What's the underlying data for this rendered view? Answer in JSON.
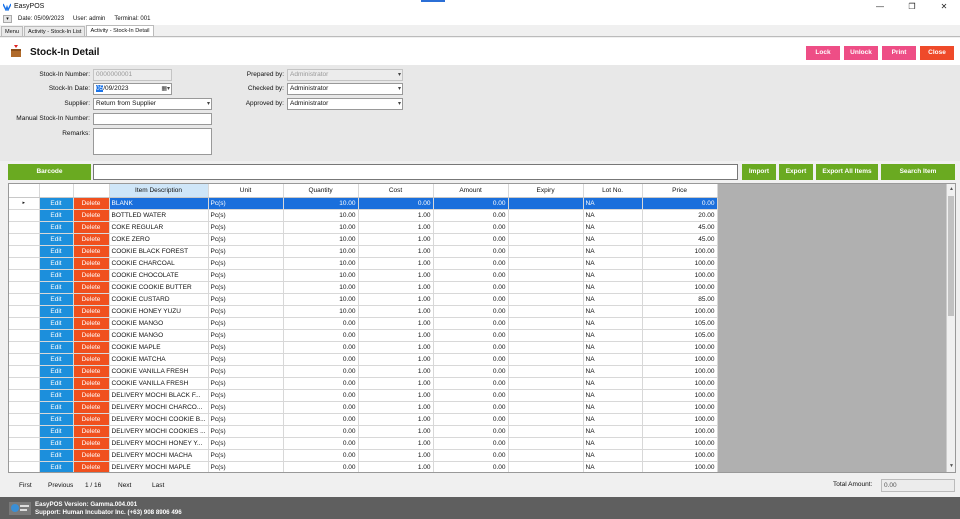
{
  "window": {
    "title": "EasyPOS",
    "controls": [
      "—",
      "❐",
      "✕"
    ]
  },
  "info": {
    "date": "Date: 05/09/2023",
    "user": "User: admin",
    "terminal": "Terminal: 001"
  },
  "tabs": [
    "Menu",
    "Activity - Stock-In List",
    "Activity - Stock-In Detail"
  ],
  "page_title": "Stock-In Detail",
  "buttons": {
    "lock": "Lock",
    "unlock": "Unlock",
    "print": "Print",
    "close": "Close"
  },
  "form": {
    "stockin_number_label": "Stock-In Number:",
    "stockin_number": "0000000001",
    "stockin_date_label": "Stock-In Date:",
    "stockin_date_sel": "05",
    "stockin_date_rest": "/09/2023",
    "supplier_label": "Supplier:",
    "supplier": "Return from Supplier",
    "manual_label": "Manual Stock-In Number:",
    "manual": "",
    "remarks_label": "Remarks:",
    "remarks": "",
    "prepared_label": "Prepared by:",
    "prepared": "Administrator",
    "checked_label": "Checked by:",
    "checked": "Administrator",
    "approved_label": "Approved by:",
    "approved": "Administrator"
  },
  "toolbar": {
    "barcode": "Barcode",
    "import": "Import",
    "export": "Export",
    "export_all": "Export All Items",
    "search": "Search Item"
  },
  "grid": {
    "columns": [
      "Item Description",
      "Unit",
      "Quantity",
      "Cost",
      "Amount",
      "Expiry",
      "Lot No.",
      "Price"
    ],
    "edit_label": "Edit",
    "delete_label": "Delete",
    "rows": [
      [
        "BLANK",
        "Pc(s)",
        "10.00",
        "0.00",
        "0.00",
        "",
        "NA",
        "0.00"
      ],
      [
        "BOTTLED WATER",
        "Pc(s)",
        "10.00",
        "1.00",
        "0.00",
        "",
        "NA",
        "20.00"
      ],
      [
        "COKE REGULAR",
        "Pc(s)",
        "10.00",
        "1.00",
        "0.00",
        "",
        "NA",
        "45.00"
      ],
      [
        "COKE ZERO",
        "Pc(s)",
        "10.00",
        "1.00",
        "0.00",
        "",
        "NA",
        "45.00"
      ],
      [
        "COOKIE BLACK FOREST",
        "Pc(s)",
        "10.00",
        "1.00",
        "0.00",
        "",
        "NA",
        "100.00"
      ],
      [
        "COOKIE CHARCOAL",
        "Pc(s)",
        "10.00",
        "1.00",
        "0.00",
        "",
        "NA",
        "100.00"
      ],
      [
        "COOKIE CHOCOLATE",
        "Pc(s)",
        "10.00",
        "1.00",
        "0.00",
        "",
        "NA",
        "100.00"
      ],
      [
        "COOKIE COOKIE BUTTER",
        "Pc(s)",
        "10.00",
        "1.00",
        "0.00",
        "",
        "NA",
        "100.00"
      ],
      [
        "COOKIE CUSTARD",
        "Pc(s)",
        "10.00",
        "1.00",
        "0.00",
        "",
        "NA",
        "85.00"
      ],
      [
        "COOKIE HONEY YUZU",
        "Pc(s)",
        "10.00",
        "1.00",
        "0.00",
        "",
        "NA",
        "100.00"
      ],
      [
        "COOKIE MANGO",
        "Pc(s)",
        "0.00",
        "1.00",
        "0.00",
        "",
        "NA",
        "105.00"
      ],
      [
        "COOKIE MANGO",
        "Pc(s)",
        "0.00",
        "1.00",
        "0.00",
        "",
        "NA",
        "105.00"
      ],
      [
        "COOKIE MAPLE",
        "Pc(s)",
        "0.00",
        "1.00",
        "0.00",
        "",
        "NA",
        "100.00"
      ],
      [
        "COOKIE MATCHA",
        "Pc(s)",
        "0.00",
        "1.00",
        "0.00",
        "",
        "NA",
        "100.00"
      ],
      [
        "COOKIE VANILLA FRESH",
        "Pc(s)",
        "0.00",
        "1.00",
        "0.00",
        "",
        "NA",
        "100.00"
      ],
      [
        "COOKIE VANILLA FRESH",
        "Pc(s)",
        "0.00",
        "1.00",
        "0.00",
        "",
        "NA",
        "100.00"
      ],
      [
        "DELIVERY  MOCHI BLACK F...",
        "Pc(s)",
        "0.00",
        "1.00",
        "0.00",
        "",
        "NA",
        "100.00"
      ],
      [
        "DELIVERY  MOCHI CHARCO...",
        "Pc(s)",
        "0.00",
        "1.00",
        "0.00",
        "",
        "NA",
        "100.00"
      ],
      [
        "DELIVERY  MOCHI COOKIE B...",
        "Pc(s)",
        "0.00",
        "1.00",
        "0.00",
        "",
        "NA",
        "100.00"
      ],
      [
        "DELIVERY  MOCHI COOKIES ...",
        "Pc(s)",
        "0.00",
        "1.00",
        "0.00",
        "",
        "NA",
        "100.00"
      ],
      [
        "DELIVERY  MOCHI HONEY Y...",
        "Pc(s)",
        "0.00",
        "1.00",
        "0.00",
        "",
        "NA",
        "100.00"
      ],
      [
        "DELIVERY  MOCHI MACHA",
        "Pc(s)",
        "0.00",
        "1.00",
        "0.00",
        "",
        "NA",
        "100.00"
      ],
      [
        "DELIVERY  MOCHI MAPLE",
        "Pc(s)",
        "0.00",
        "1.00",
        "0.00",
        "",
        "NA",
        "100.00"
      ]
    ]
  },
  "pager": {
    "first": "First",
    "previous": "Previous",
    "page": "1 / 16",
    "next": "Next",
    "last": "Last"
  },
  "total": {
    "label": "Total Amount:",
    "value": "0.00"
  },
  "footer": {
    "version": "EasyPOS Version: Gamma.004.001",
    "support": "Support: Human Incubator Inc. (+63) 908 8906 496"
  },
  "colors": {
    "pink": "#ee4e86",
    "red": "#ef4a2a",
    "green": "#6aaa21",
    "edit": "#1c8fdc",
    "delete": "#f0501e",
    "selected": "#1a6fdc"
  }
}
